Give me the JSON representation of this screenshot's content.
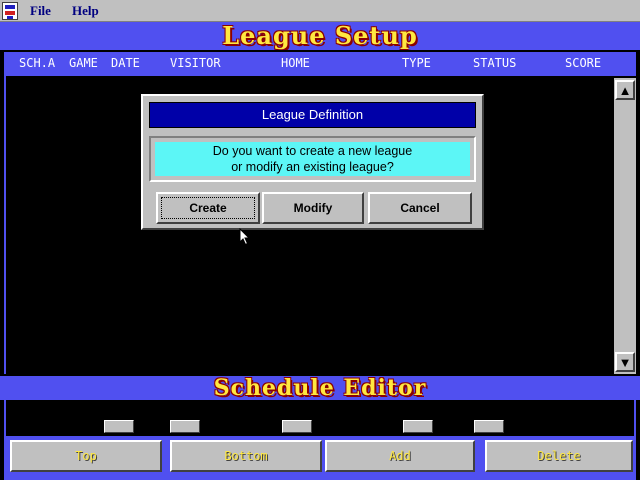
{
  "menu": {
    "file": "File",
    "help": "Help"
  },
  "banners": {
    "top": "League Setup",
    "bottom": "Schedule Editor"
  },
  "columns": {
    "sch_a": "SCH.A",
    "game": "GAME",
    "date": "DATE",
    "visitor": "VISITOR",
    "home": "HOME",
    "type": "TYPE",
    "status": "STATUS",
    "score": "SCORE"
  },
  "scrollbar": {
    "up_icon": "▲",
    "down_icon": "▼"
  },
  "dialog": {
    "title": "League Definition",
    "message_line1": "Do you want to create a new league",
    "message_line2": "or modify an existing league?",
    "buttons": {
      "create": "Create",
      "modify": "Modify",
      "cancel": "Cancel"
    }
  },
  "bottom_buttons": {
    "top": "Top",
    "bottom": "Bottom",
    "add": "Add",
    "delete": "Delete"
  },
  "colors": {
    "banner_blue": "#5050f0",
    "banner_text": "#ffe840",
    "dialog_title": "#0000a8",
    "message_bg": "#5cf6f6",
    "button_face": "#c0c0c0"
  }
}
